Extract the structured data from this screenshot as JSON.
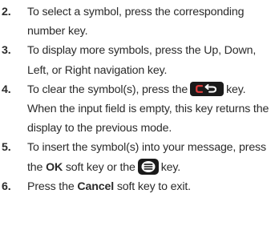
{
  "steps": [
    {
      "number": "2.",
      "text": "To select a symbol, press the corresponding number key."
    },
    {
      "number": "3.",
      "text": "To display more symbols, press the Up, Down, Left, or Right navigation key."
    },
    {
      "number": "4.",
      "pre": "To clear the symbol(s), press the",
      "icon": "clear-back-key-icon",
      "post": "key. When the input field is empty, this key returns the display to the previous mode."
    },
    {
      "number": "5.",
      "pre": "To insert the symbol(s) into your message, press the",
      "bold": "OK",
      "mid": "soft key or the",
      "icon": "ok-select-key-icon",
      "post": "key."
    },
    {
      "number": "6.",
      "pre": "Press the",
      "bold": "Cancel",
      "post": "soft key to exit."
    }
  ],
  "colors": {
    "text": "#2b2b2b",
    "key_background": "#1a1a1a",
    "key_glyph_red": "#e23b3b",
    "key_glyph_white": "#ffffff"
  }
}
